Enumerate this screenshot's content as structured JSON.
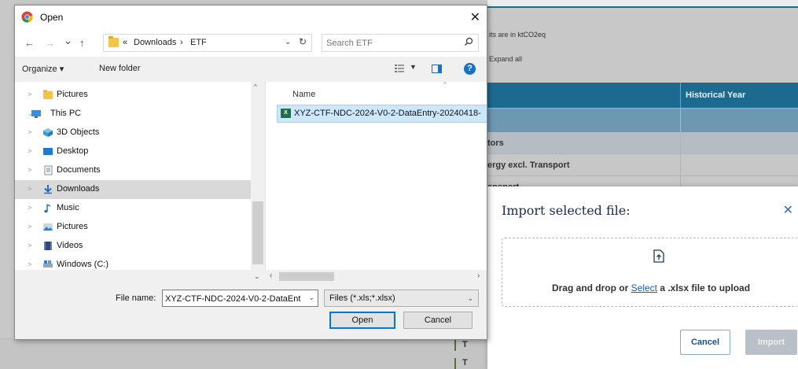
{
  "background": {
    "units_note": "its are in ktCO2eq",
    "expand_link": "Expand all",
    "table_header": "Historical Year",
    "rows": [
      "tors",
      "ergy excl. Transport",
      "ansport"
    ],
    "bottom_marks": [
      "T",
      "T"
    ]
  },
  "import_modal": {
    "title": "Import selected file:",
    "close_icon": "close-icon",
    "upload_icon": "upload-file-icon",
    "drop_text_before": "Drag and drop or ",
    "drop_link": "Select",
    "drop_text_after": " a .xlsx file to upload",
    "cancel_label": "Cancel",
    "import_label": "Import",
    "accent": "#1a5ea8"
  },
  "dialog": {
    "title": "Open",
    "close_glyph": "✕",
    "nav": {
      "back": "←",
      "forward": "→",
      "recent": "⌄",
      "up": "↑"
    },
    "breadcrumb": [
      "«",
      "Downloads",
      "›",
      "ETF"
    ],
    "search_placeholder": "Search ETF",
    "toolbar": {
      "organize": "Organize ▾",
      "new_folder": "New folder"
    },
    "nav_pane": [
      {
        "label": "Pictures",
        "icon": "folder-icon",
        "expand": ">",
        "indent": 1
      },
      {
        "label": "This PC",
        "icon": "computer-icon",
        "expand": "⌄",
        "indent": 0
      },
      {
        "label": "3D Objects",
        "icon": "3d-objects-icon",
        "expand": ">",
        "indent": 1
      },
      {
        "label": "Desktop",
        "icon": "desktop-icon",
        "expand": ">",
        "indent": 1
      },
      {
        "label": "Documents",
        "icon": "documents-icon",
        "expand": ">",
        "indent": 1
      },
      {
        "label": "Downloads",
        "icon": "downloads-icon",
        "expand": ">",
        "indent": 1,
        "selected": true
      },
      {
        "label": "Music",
        "icon": "music-icon",
        "expand": ">",
        "indent": 1
      },
      {
        "label": "Pictures",
        "icon": "pictures-icon",
        "expand": ">",
        "indent": 1
      },
      {
        "label": "Videos",
        "icon": "videos-icon",
        "expand": ">",
        "indent": 1
      },
      {
        "label": "Windows (C:)",
        "icon": "drive-icon",
        "expand": ">",
        "indent": 1
      }
    ],
    "file_list": {
      "column_name": "Name",
      "files": [
        {
          "name": "XYZ-CTF-NDC-2024-V0-2-DataEntry-20240418-",
          "icon": "excel-file-icon",
          "selected": true
        }
      ]
    },
    "file_name_label": "File name:",
    "file_name_value": "XYZ-CTF-NDC-2024-V0-2-DataEnt",
    "filter_value": "Files (*.xls;*.xlsx)",
    "open_label": "Open",
    "cancel_label": "Cancel",
    "accent": "#0078d7"
  }
}
